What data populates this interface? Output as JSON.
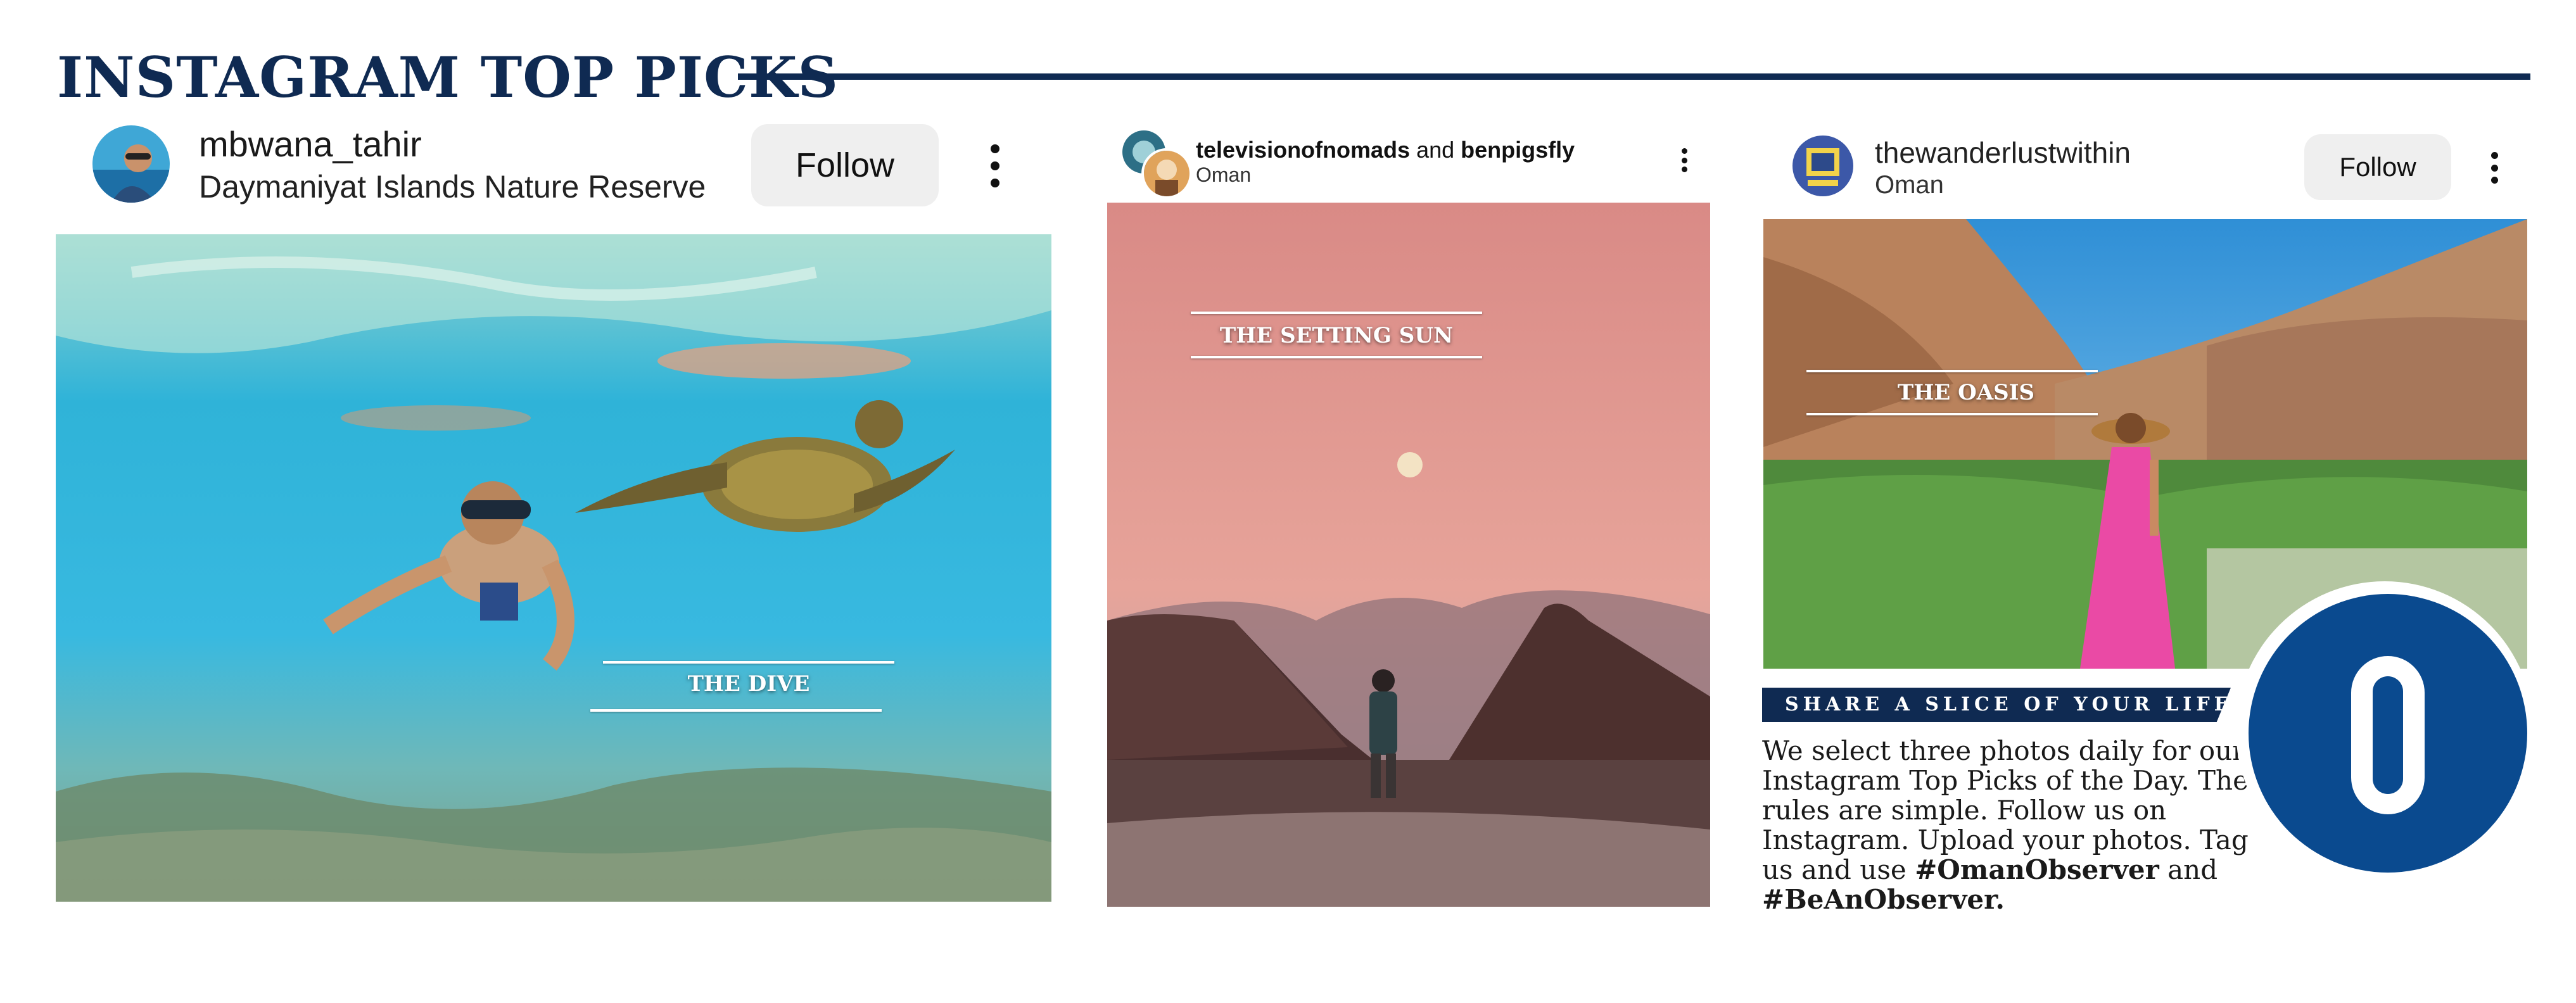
{
  "header": {
    "title": "INSTAGRAM TOP PICKS"
  },
  "posts": [
    {
      "username": "mbwana_tahir",
      "location": "Daymaniyat Islands Nature Reserve",
      "follow_label": "Follow",
      "caption": "THE DIVE",
      "avatar_icon": "snorkeler-avatar-icon"
    },
    {
      "username_1": "televisionofnomads",
      "joiner": "and",
      "username_2": "benpigsfly",
      "location": "Oman",
      "caption": "THE SETTING SUN",
      "avatar_icon": "dual-avatar-icon"
    },
    {
      "username": "thewanderlustwithin",
      "location": "Oman",
      "follow_label": "Follow",
      "caption": "THE OASIS",
      "avatar_icon": "frame-avatar-icon"
    }
  ],
  "promo": {
    "banner": "SHARE A SLICE OF YOUR LIFE",
    "text_before": "We select three photos daily for our Instagram Top Picks of the Day. The rules are simple. Follow us on Instagram. Upload your photos. Tag us and use",
    "hashtag_1": "#OmanObserver",
    "joiner": "and",
    "hashtag_2": "#BeAnObserver.",
    "logo_letter": "O"
  },
  "colors": {
    "brand_navy": "#0f2a52",
    "logo_blue": "#0a4a8f",
    "button_grey": "#efefef"
  }
}
